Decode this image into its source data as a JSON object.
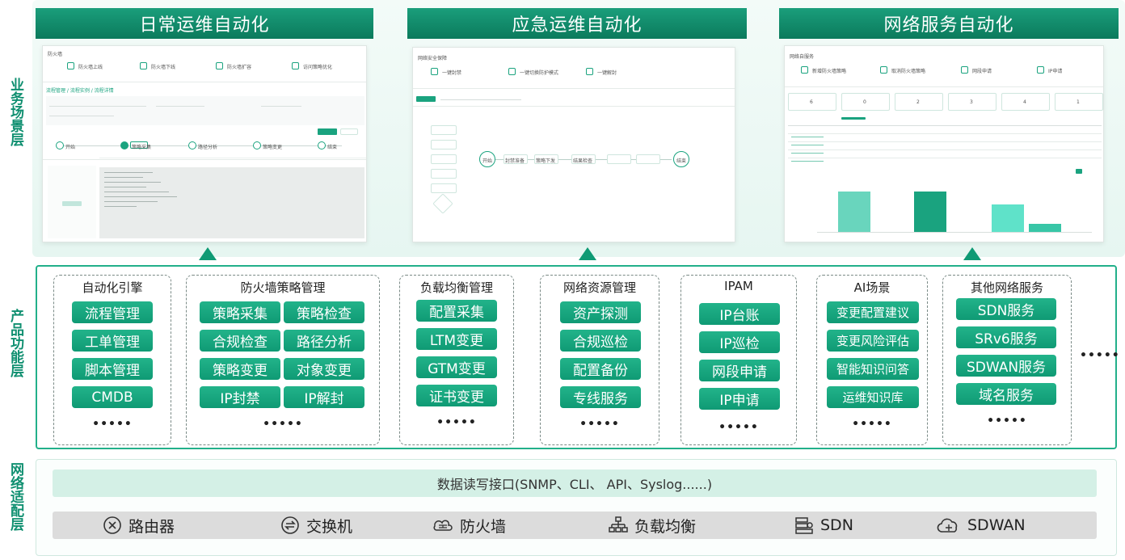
{
  "layers": {
    "business": "业务场景层",
    "product": "产品功能层",
    "network": "网络适配层"
  },
  "scenes": [
    {
      "title": "日常运维自动化",
      "page_heading": "防火墙",
      "cards": [
        "防火墙上线",
        "防火墙下线",
        "防火墙扩容",
        "访问策略优化"
      ],
      "breadcrumb": "流程管理 / 流程实例 / 流程详情",
      "steps": [
        "开始",
        "策略采集",
        "路径分析",
        "策略变更",
        "结束"
      ]
    },
    {
      "title": "应急运维自动化",
      "page_heading": "网络安全保障",
      "cards": [
        "一键封禁",
        "一键切换防护模式",
        "一键解封"
      ],
      "flow_nodes": [
        "开始",
        "封禁准备",
        "策略下发",
        "结果检查",
        "结束"
      ]
    },
    {
      "title": "网络服务自动化",
      "page_heading": "网络自服务",
      "cards": [
        "新增防火墙策略",
        "取消防火墙策略",
        "网段申请",
        "IP申请"
      ],
      "stats": [
        "6",
        "0",
        "2",
        "3",
        "4",
        "1"
      ]
    }
  ],
  "groups": [
    {
      "title": "自动化引擎",
      "items": [
        "流程管理",
        "工单管理",
        "脚本管理",
        "CMDB"
      ],
      "more": "•••••"
    },
    {
      "title": "防火墙策略管理",
      "items": [
        "策略采集",
        "策略检查",
        "合规检查",
        "路径分析",
        "策略变更",
        "对象变更",
        "IP封禁",
        "IP解封"
      ],
      "more": "•••••"
    },
    {
      "title": "负载均衡管理",
      "items": [
        "配置采集",
        "LTM变更",
        "GTM变更",
        "证书变更"
      ],
      "more": "•••••"
    },
    {
      "title": "网络资源管理",
      "items": [
        "资产探测",
        "合规巡检",
        "配置备份",
        "专线服务"
      ],
      "more": "•••••"
    },
    {
      "title": "IPAM",
      "items": [
        "IP台账",
        "IP巡检",
        "网段申请",
        "IP申请"
      ],
      "more": "•••••"
    },
    {
      "title": "AI场景",
      "items": [
        "变更配置建议",
        "变更风险评估",
        "智能知识问答",
        "运维知识库"
      ],
      "more": "•••••"
    },
    {
      "title": "其他网络服务",
      "items": [
        "SDN服务",
        "SRv6服务",
        "SDWAN服务",
        "域名服务"
      ],
      "more": "•••••"
    }
  ],
  "outer_more": "•••••",
  "network": {
    "interface": "数据读写接口(SNMP、CLI、 API、Syslog......)",
    "devices": [
      {
        "label": "路由器",
        "icon": "router-icon"
      },
      {
        "label": "交换机",
        "icon": "switch-icon"
      },
      {
        "label": "防火墙",
        "icon": "firewall-icon"
      },
      {
        "label": "负载均衡",
        "icon": "load-balancer-icon"
      },
      {
        "label": "SDN",
        "icon": "sdn-icon"
      },
      {
        "label": "SDWAN",
        "icon": "cloud-icon"
      }
    ]
  },
  "colors": {
    "accent": "#0f9a74",
    "title_bar": "#0b7a5c",
    "interface_bg": "#d4f0e6",
    "device_bar": "#dcdcdc"
  }
}
